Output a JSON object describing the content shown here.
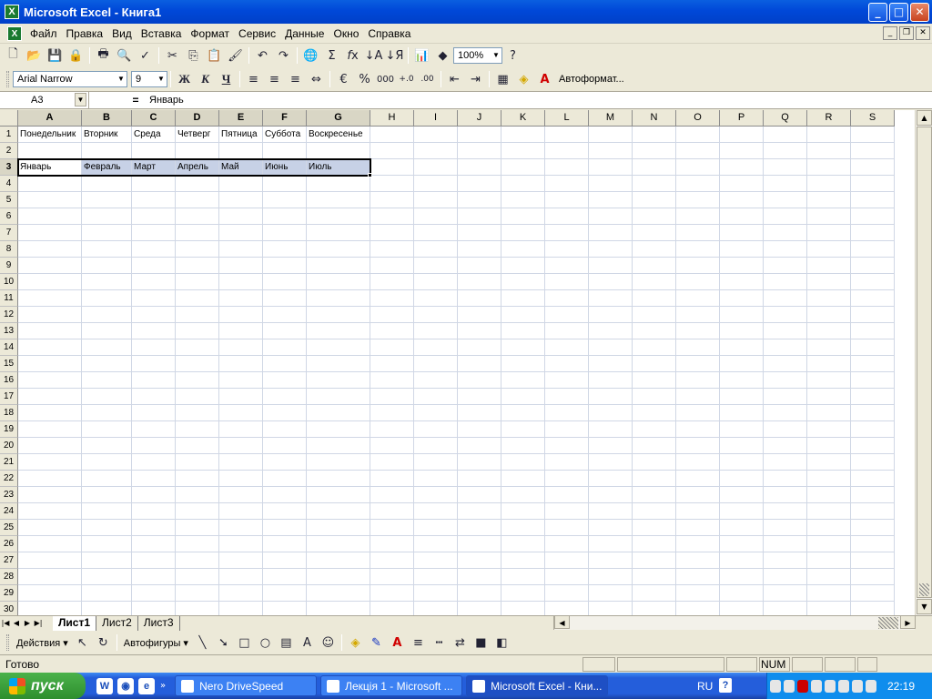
{
  "window": {
    "title": "Microsoft Excel - Книга1",
    "buttons": [
      "_",
      "□",
      "✕"
    ]
  },
  "menu": {
    "items": [
      "Файл",
      "Правка",
      "Вид",
      "Вставка",
      "Формат",
      "Сервис",
      "Данные",
      "Окно",
      "Справка"
    ]
  },
  "standard_toolbar": {
    "zoom": "100%"
  },
  "format_toolbar": {
    "font": "Arial Narrow",
    "size": "9",
    "bold": "Ж",
    "italic": "К",
    "underline": "Ч",
    "percent": "%",
    "thousands": "000",
    "autoformat": "Автоформат..."
  },
  "formula_bar": {
    "cell_ref": "A3",
    "eq": "=",
    "content": "Январь"
  },
  "sheet": {
    "columns": [
      "A",
      "B",
      "C",
      "D",
      "E",
      "F",
      "G",
      "H",
      "I",
      "J",
      "K",
      "L",
      "M",
      "N",
      "O",
      "P",
      "Q",
      "R",
      "S"
    ],
    "rows": [
      "1",
      "2",
      "3",
      "4",
      "5",
      "6",
      "7",
      "8",
      "9",
      "10",
      "11",
      "12",
      "13",
      "14",
      "15",
      "16",
      "17",
      "18",
      "19",
      "20",
      "21",
      "22",
      "23",
      "24",
      "25",
      "26",
      "27",
      "28",
      "29",
      "30"
    ],
    "row1": [
      "Понедельник",
      "Вторник",
      "Среда",
      "Четверг",
      "Пятница",
      "Суббота",
      "Воскресенье"
    ],
    "row3": [
      "Январь",
      "Февраль",
      "Март",
      "Апрель",
      "Май",
      "Июнь",
      "Июль"
    ],
    "selected_row": "3",
    "selected_columns": [
      "A",
      "B",
      "C",
      "D",
      "E",
      "F",
      "G"
    ]
  },
  "tabs": {
    "nav": [
      "|◀",
      "◀",
      "▶",
      "▶|"
    ],
    "sheets": [
      "Лист1",
      "Лист2",
      "Лист3"
    ],
    "active": "Лист1"
  },
  "drawing_toolbar": {
    "actions": "Действия",
    "autoshapes": "Автофигуры"
  },
  "status": {
    "ready": "Готово",
    "num": "NUM"
  },
  "taskbar": {
    "start": "пуск",
    "tasks": [
      "Nero DriveSpeed",
      "Лекція 1 - Microsoft ...",
      "Microsoft Excel - Кни..."
    ],
    "lang": "RU",
    "time": "22:19"
  },
  "colors": {
    "selection": "#c7d1e6",
    "titlebar": "#0a5fe0",
    "taskbar": "#245edb"
  }
}
